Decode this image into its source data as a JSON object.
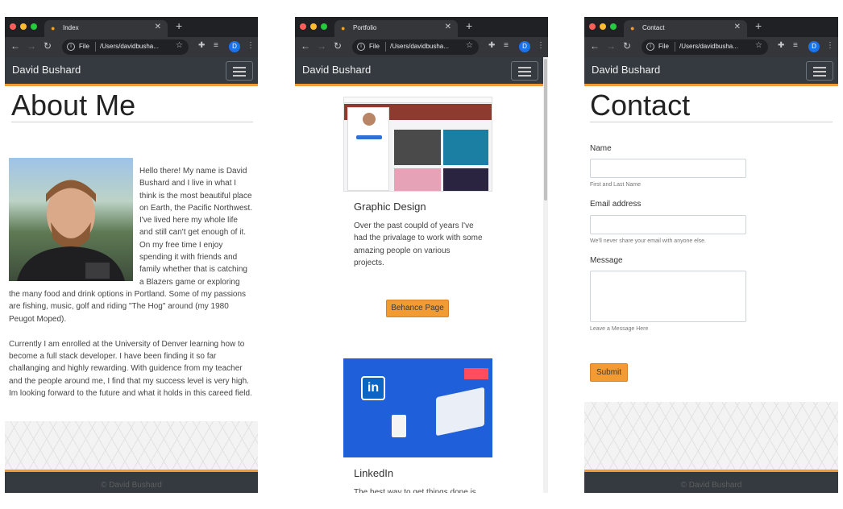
{
  "colors": {
    "accent": "#f29b33",
    "navbar": "#343a40",
    "chrome_dark": "#202124",
    "chrome_light": "#35363a"
  },
  "browser": {
    "scheme": "File",
    "path": "/Users/davidbusha...",
    "avatar_letter": "D"
  },
  "windows": [
    {
      "tab_title": "Index"
    },
    {
      "tab_title": "Portfolio"
    },
    {
      "tab_title": "Contact"
    }
  ],
  "site": {
    "brand": "David Bushard",
    "footer": "© David Bushard"
  },
  "about": {
    "heading": "About Me",
    "photo_alt": "Portrait of David Bushard",
    "paragraph1": "Hello there! My name is David Bushard and I live in what I think is the most beautiful place on Earth, the Pacific Northwest. I've lived here my whole life and still can't get enough of it. On my free time I enjoy spending it with friends and family whether that is catching a Blazers game or exploring the many food and drink options in Portland. Some of my passions are fishing, music, golf and riding \"The Hog\" around (my 1980 Peugot Moped).",
    "paragraph2": "Currently I am enrolled at the University of Denver learning how to become a full stack developer. I have been finding it so far challanging and highly rewarding. With guidence from my teacher and the people around me, I find that my success level is very high. Im looking forward to the future and what it holds in this careed field."
  },
  "portfolio": {
    "cards": [
      {
        "title": "Graphic Design",
        "text": "Over the past coupld of years I've had the privalage to work with some amazing people on various projects.",
        "button": "Behance Page"
      },
      {
        "title": "LinkedIn",
        "text": "The best way to get things done is"
      }
    ]
  },
  "contact": {
    "heading": "Contact",
    "name_label": "Name",
    "name_help": "First and Last Name",
    "email_label": "Email address",
    "email_help": "We'll never share your email with anyone else.",
    "message_label": "Message",
    "message_help": "Leave a Message Here",
    "submit": "Submit"
  }
}
